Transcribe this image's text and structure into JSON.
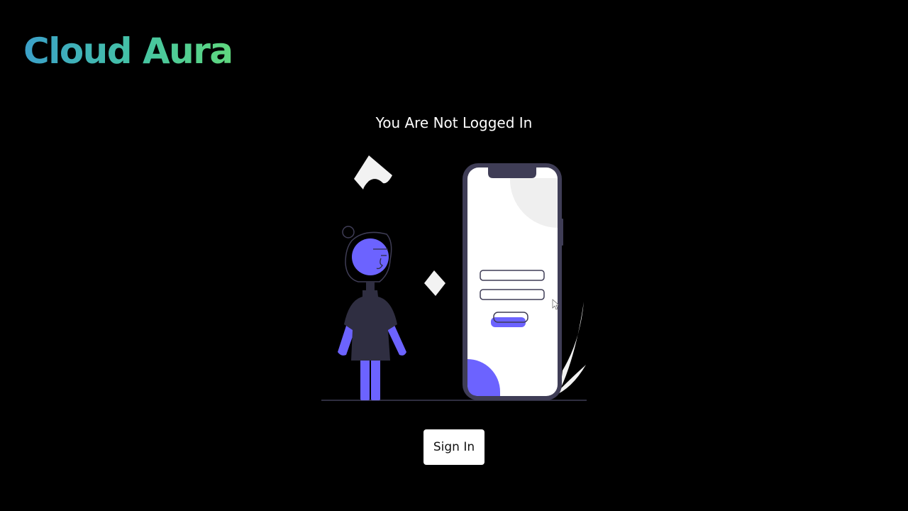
{
  "brand": {
    "name": "Cloud Aura",
    "gradient_start": "#3ba0c9",
    "gradient_end": "#5fd87e"
  },
  "main": {
    "heading": "You Are Not Logged In",
    "sign_in_label": "Sign In"
  },
  "illustration": {
    "icon": "login-illustration",
    "accent_color": "#6c63ff",
    "dark_color": "#3f3d56"
  }
}
